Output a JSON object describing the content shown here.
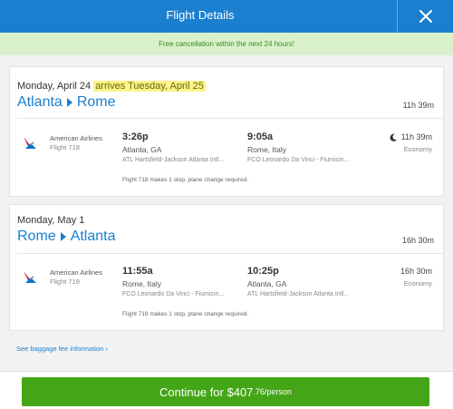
{
  "header": {
    "title": "Flight Details",
    "close_icon": "close-icon"
  },
  "notice": "Free cancellation within the next 24 hours!",
  "outbound": {
    "date": "Monday, April 24",
    "arrives_note": "arrives Tuesday, April 25",
    "origin": "Atlanta",
    "destination": "Rome",
    "total_duration": "11h 39m",
    "airline": "American Airlines",
    "flight_number": "Flight 718",
    "depart_time": "3:26p",
    "depart_city": "Atlanta, GA",
    "depart_airport": "ATL Hartsfield-Jackson Atlanta Intl...",
    "arrive_time": "9:05a",
    "arrive_city": "Rome, Italy",
    "arrive_airport": "FCO Leonardo Da Vinci - Fiumicin...",
    "segment_duration": "11h 39m",
    "cabin": "Economy",
    "stops_note": "Flight 718 makes 1 stop, plane change required."
  },
  "return": {
    "date": "Monday, May 1",
    "origin": "Rome",
    "destination": "Atlanta",
    "total_duration": "16h 30m",
    "airline": "American Airlines",
    "flight_number": "Flight 719",
    "depart_time": "11:55a",
    "depart_city": "Rome, Italy",
    "depart_airport": "FCO Leonardo Da Vinci - Fiumicin...",
    "arrive_time": "10:25p",
    "arrive_city": "Atlanta, GA",
    "arrive_airport": "ATL Hartsfield-Jackson Atlanta Intl...",
    "segment_duration": "16h 30m",
    "cabin": "Economy",
    "stops_note": "Flight 719 makes 1 stop, plane change required."
  },
  "baggage_link": "See baggage fee information",
  "continue": {
    "label": "Continue for $407",
    "cents": ".76/person"
  },
  "colors": {
    "brand_blue": "#1a7fcf",
    "notice_bg": "#d9f2cc",
    "cta_green": "#44a616",
    "highlight": "#fdf28b"
  }
}
